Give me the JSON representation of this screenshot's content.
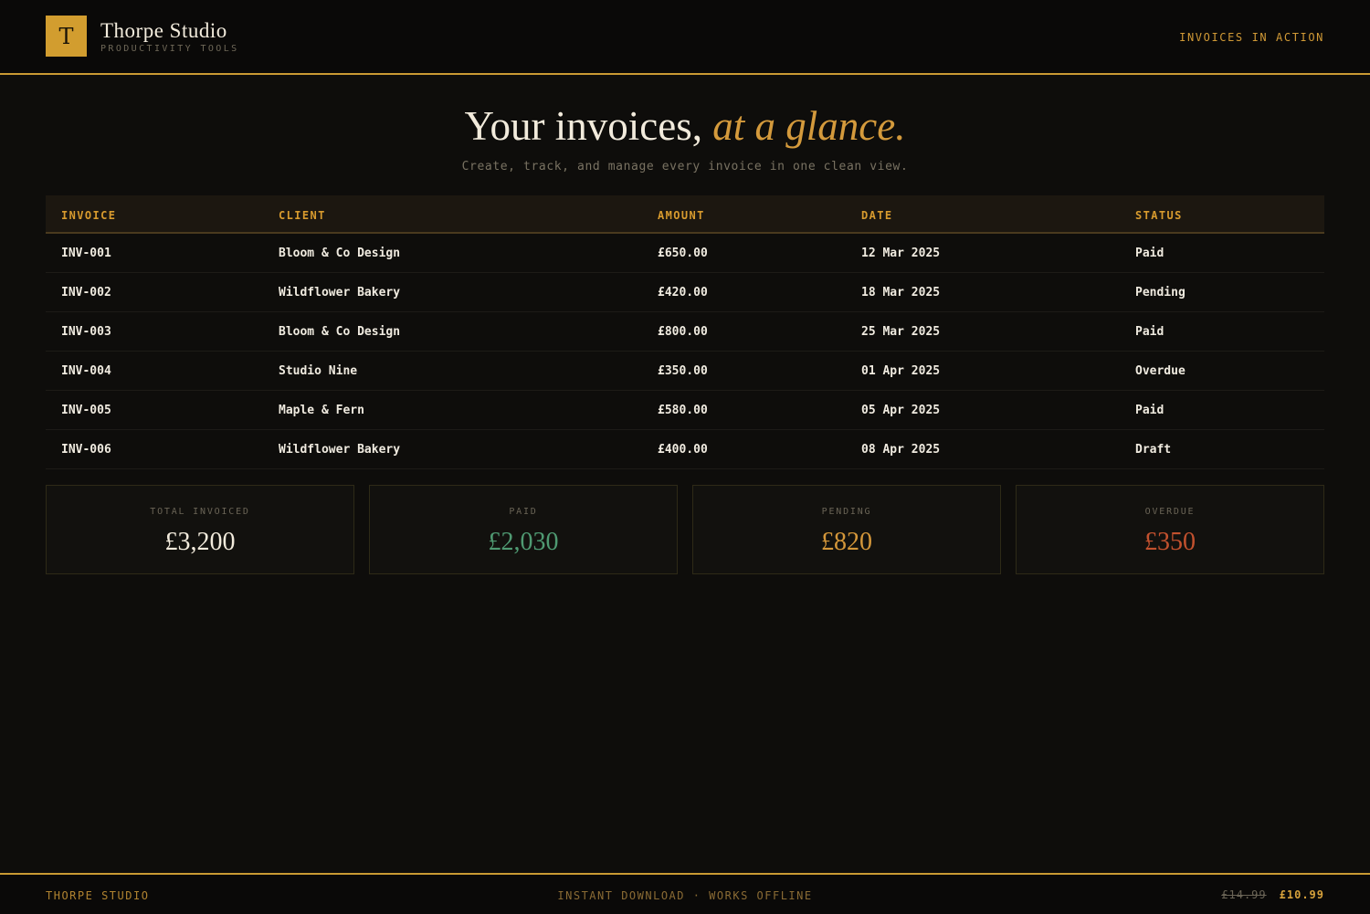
{
  "header": {
    "logo_letter": "T",
    "brand_name": "Thorpe Studio",
    "brand_tagline": "PRODUCTIVITY TOOLS",
    "nav_link": "INVOICES IN ACTION"
  },
  "hero": {
    "title_main": "Your invoices,",
    "title_accent": "at a glance.",
    "subtitle": "Create, track, and manage every invoice in one clean view."
  },
  "table": {
    "columns": [
      "INVOICE",
      "CLIENT",
      "AMOUNT",
      "DATE",
      "STATUS"
    ],
    "rows": [
      {
        "invoice": "INV-001",
        "client": "Bloom & Co Design",
        "amount": "£650.00",
        "date": "12 Mar 2025",
        "status": "Paid"
      },
      {
        "invoice": "INV-002",
        "client": "Wildflower Bakery",
        "amount": "£420.00",
        "date": "18 Mar 2025",
        "status": "Pending"
      },
      {
        "invoice": "INV-003",
        "client": "Bloom & Co Design",
        "amount": "£800.00",
        "date": "25 Mar 2025",
        "status": "Paid"
      },
      {
        "invoice": "INV-004",
        "client": "Studio Nine",
        "amount": "£350.00",
        "date": "01 Apr 2025",
        "status": "Overdue"
      },
      {
        "invoice": "INV-005",
        "client": "Maple & Fern",
        "amount": "£580.00",
        "date": "05 Apr 2025",
        "status": "Paid"
      },
      {
        "invoice": "INV-006",
        "client": "Wildflower Bakery",
        "amount": "£400.00",
        "date": "08 Apr 2025",
        "status": "Draft"
      }
    ]
  },
  "stats": [
    {
      "label": "TOTAL INVOICED",
      "value": "£3,200",
      "color": "#f2ebdc"
    },
    {
      "label": "PAID",
      "value": "£2,030",
      "color": "#4f9a72"
    },
    {
      "label": "PENDING",
      "value": "£820",
      "color": "#d4973a"
    },
    {
      "label": "OVERDUE",
      "value": "£350",
      "color": "#c2512e"
    }
  ],
  "footer": {
    "brand": "THORPE STUDIO",
    "tagline": "INSTANT DOWNLOAD · WORKS OFFLINE",
    "old_price": "£14.99",
    "new_price": "£10.99"
  },
  "colors": {
    "accent": "#d29d2f",
    "background": "#0e0d0b",
    "paid": "#4f9a72",
    "pending": "#d4973a",
    "overdue": "#c2512e"
  }
}
